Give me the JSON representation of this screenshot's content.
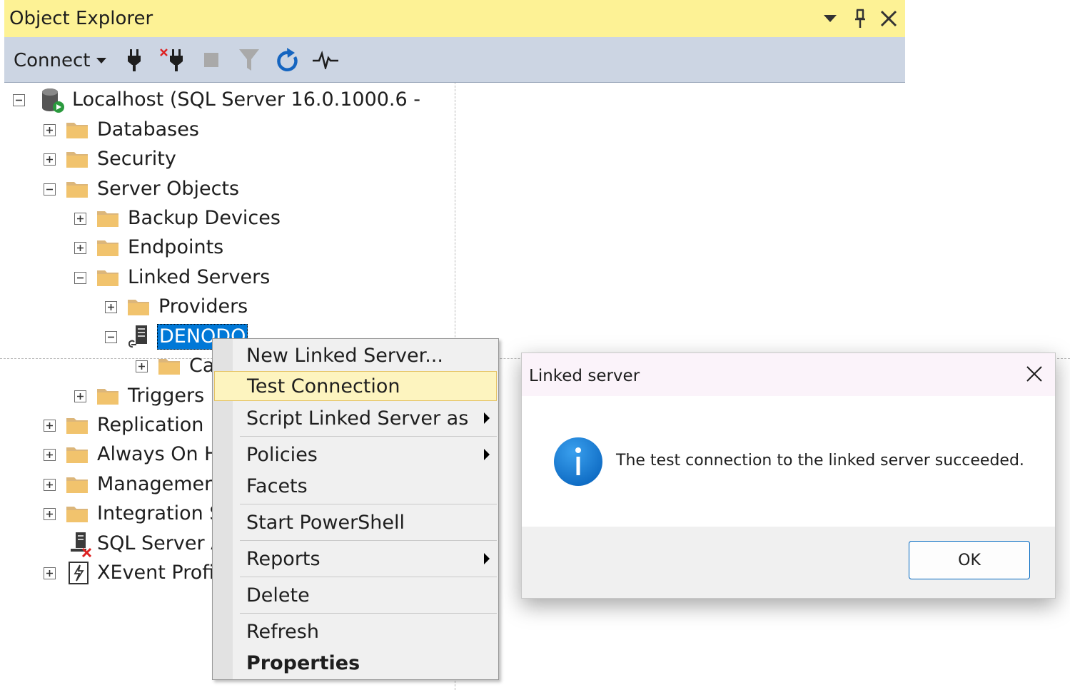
{
  "object_explorer": {
    "title": "Object Explorer",
    "toolbar": {
      "connect_label": "Connect"
    },
    "tree": {
      "root": "Localhost (SQL Server 16.0.1000.6 -",
      "databases": "Databases",
      "security": "Security",
      "server_objects": "Server Objects",
      "backup_devices": "Backup Devices",
      "endpoints": "Endpoints",
      "linked_servers": "Linked Servers",
      "providers": "Providers",
      "denodo": "DENODO",
      "catalogs": "Ca",
      "triggers": "Triggers",
      "replication": "Replication",
      "always_on": "Always On H",
      "management": "Managemer",
      "integration": "Integration S",
      "sql_server_agent": "SQL Server A",
      "xevent_profiler": "XEvent Profi"
    }
  },
  "context_menu": {
    "items": [
      {
        "label": "New Linked Server..."
      },
      {
        "label": "Test Connection"
      },
      {
        "label": "Script Linked Server as"
      },
      {
        "label": "Policies"
      },
      {
        "label": "Facets"
      },
      {
        "label": "Start PowerShell"
      },
      {
        "label": "Reports"
      },
      {
        "label": "Delete"
      },
      {
        "label": "Refresh"
      },
      {
        "label": "Properties"
      }
    ]
  },
  "dialog": {
    "title": "Linked server",
    "message": "The test connection to the linked server succeeded.",
    "ok_label": "OK"
  },
  "colors": {
    "title_bar": "#fdf295",
    "toolbar": "#ccd5e3",
    "selection": "#0078d7",
    "menu_hover": "#fdf4bf",
    "info_icon": "#1a7fd4"
  }
}
